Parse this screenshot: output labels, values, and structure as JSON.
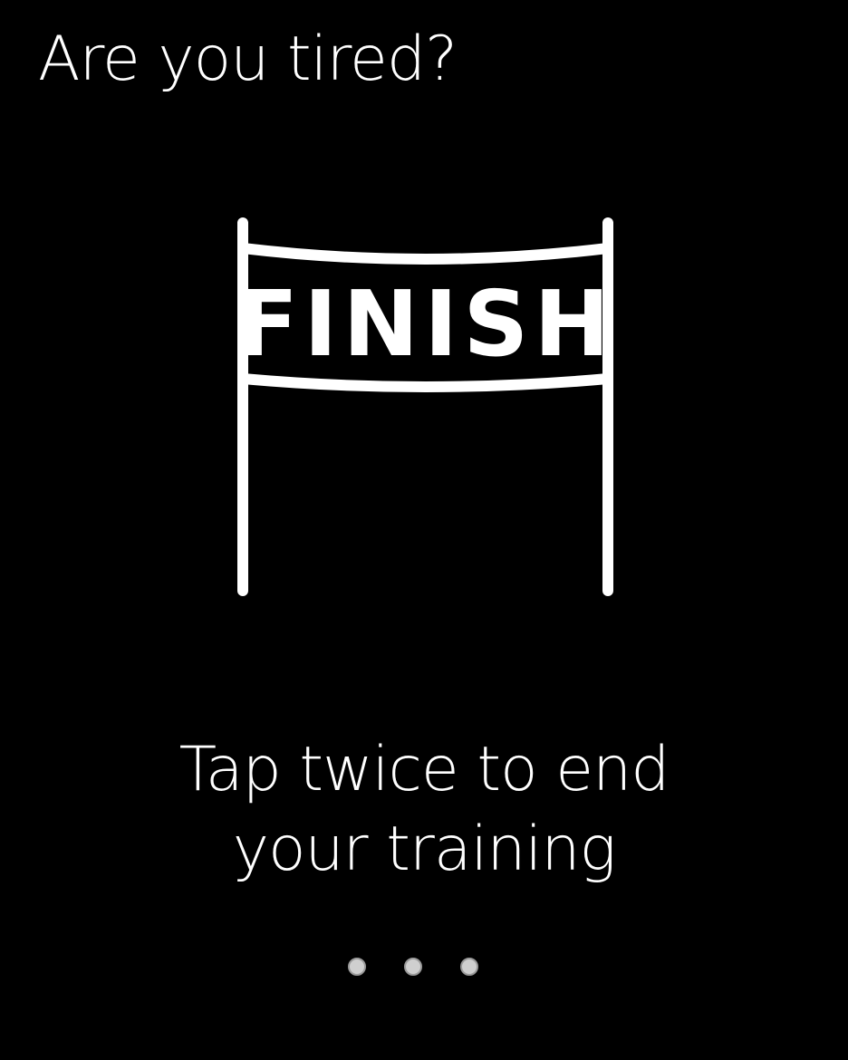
{
  "screen": {
    "title": "Are you tired?",
    "banner_text": "FINISH",
    "instruction_line1": "Tap twice to end",
    "instruction_line2": "your training"
  },
  "pager": {
    "dots": 3
  },
  "colors": {
    "background": "#000000",
    "foreground": "#ffffff",
    "dot": "#cfcfcf"
  },
  "icons": {
    "finish_banner": "finish-line-icon"
  }
}
